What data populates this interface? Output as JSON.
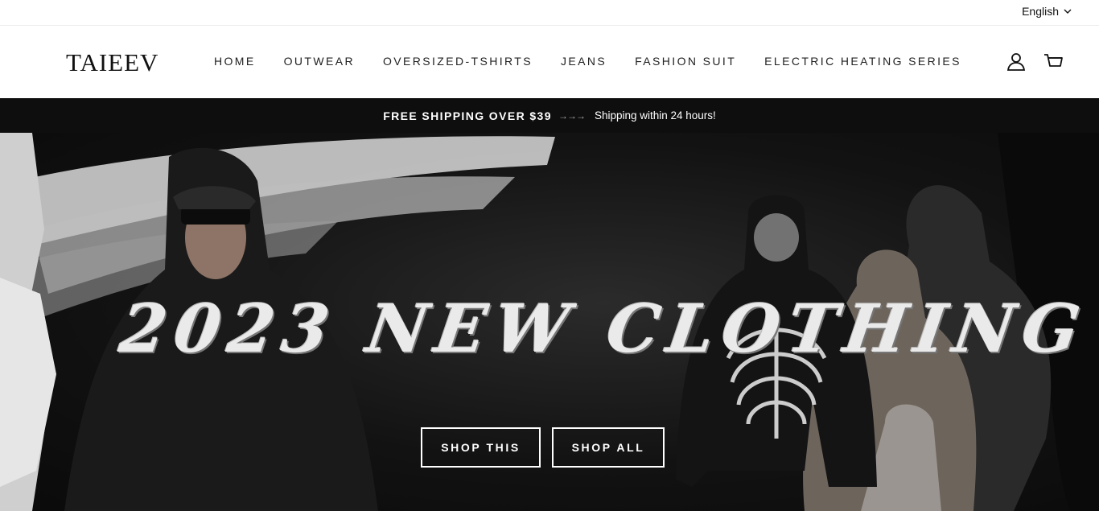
{
  "utility": {
    "language": "English"
  },
  "header": {
    "logo": "TAIEEV",
    "nav": [
      "HOME",
      "OUTWEAR",
      "OVERSIZED-TSHIRTS",
      "JEANS",
      "FASHION SUIT",
      "ELECTRIC HEATING SERIES"
    ],
    "icons": [
      "account-icon",
      "cart-icon"
    ]
  },
  "announcement": {
    "bold": "FREE SHIPPING OVER $39",
    "arrows": "→→→",
    "text": "Shipping within 24 hours!"
  },
  "hero": {
    "title": "2023 NEW CLOTHING",
    "buttons": {
      "shop_this": "SHOP THIS",
      "shop_all": "SHOP ALL"
    }
  }
}
